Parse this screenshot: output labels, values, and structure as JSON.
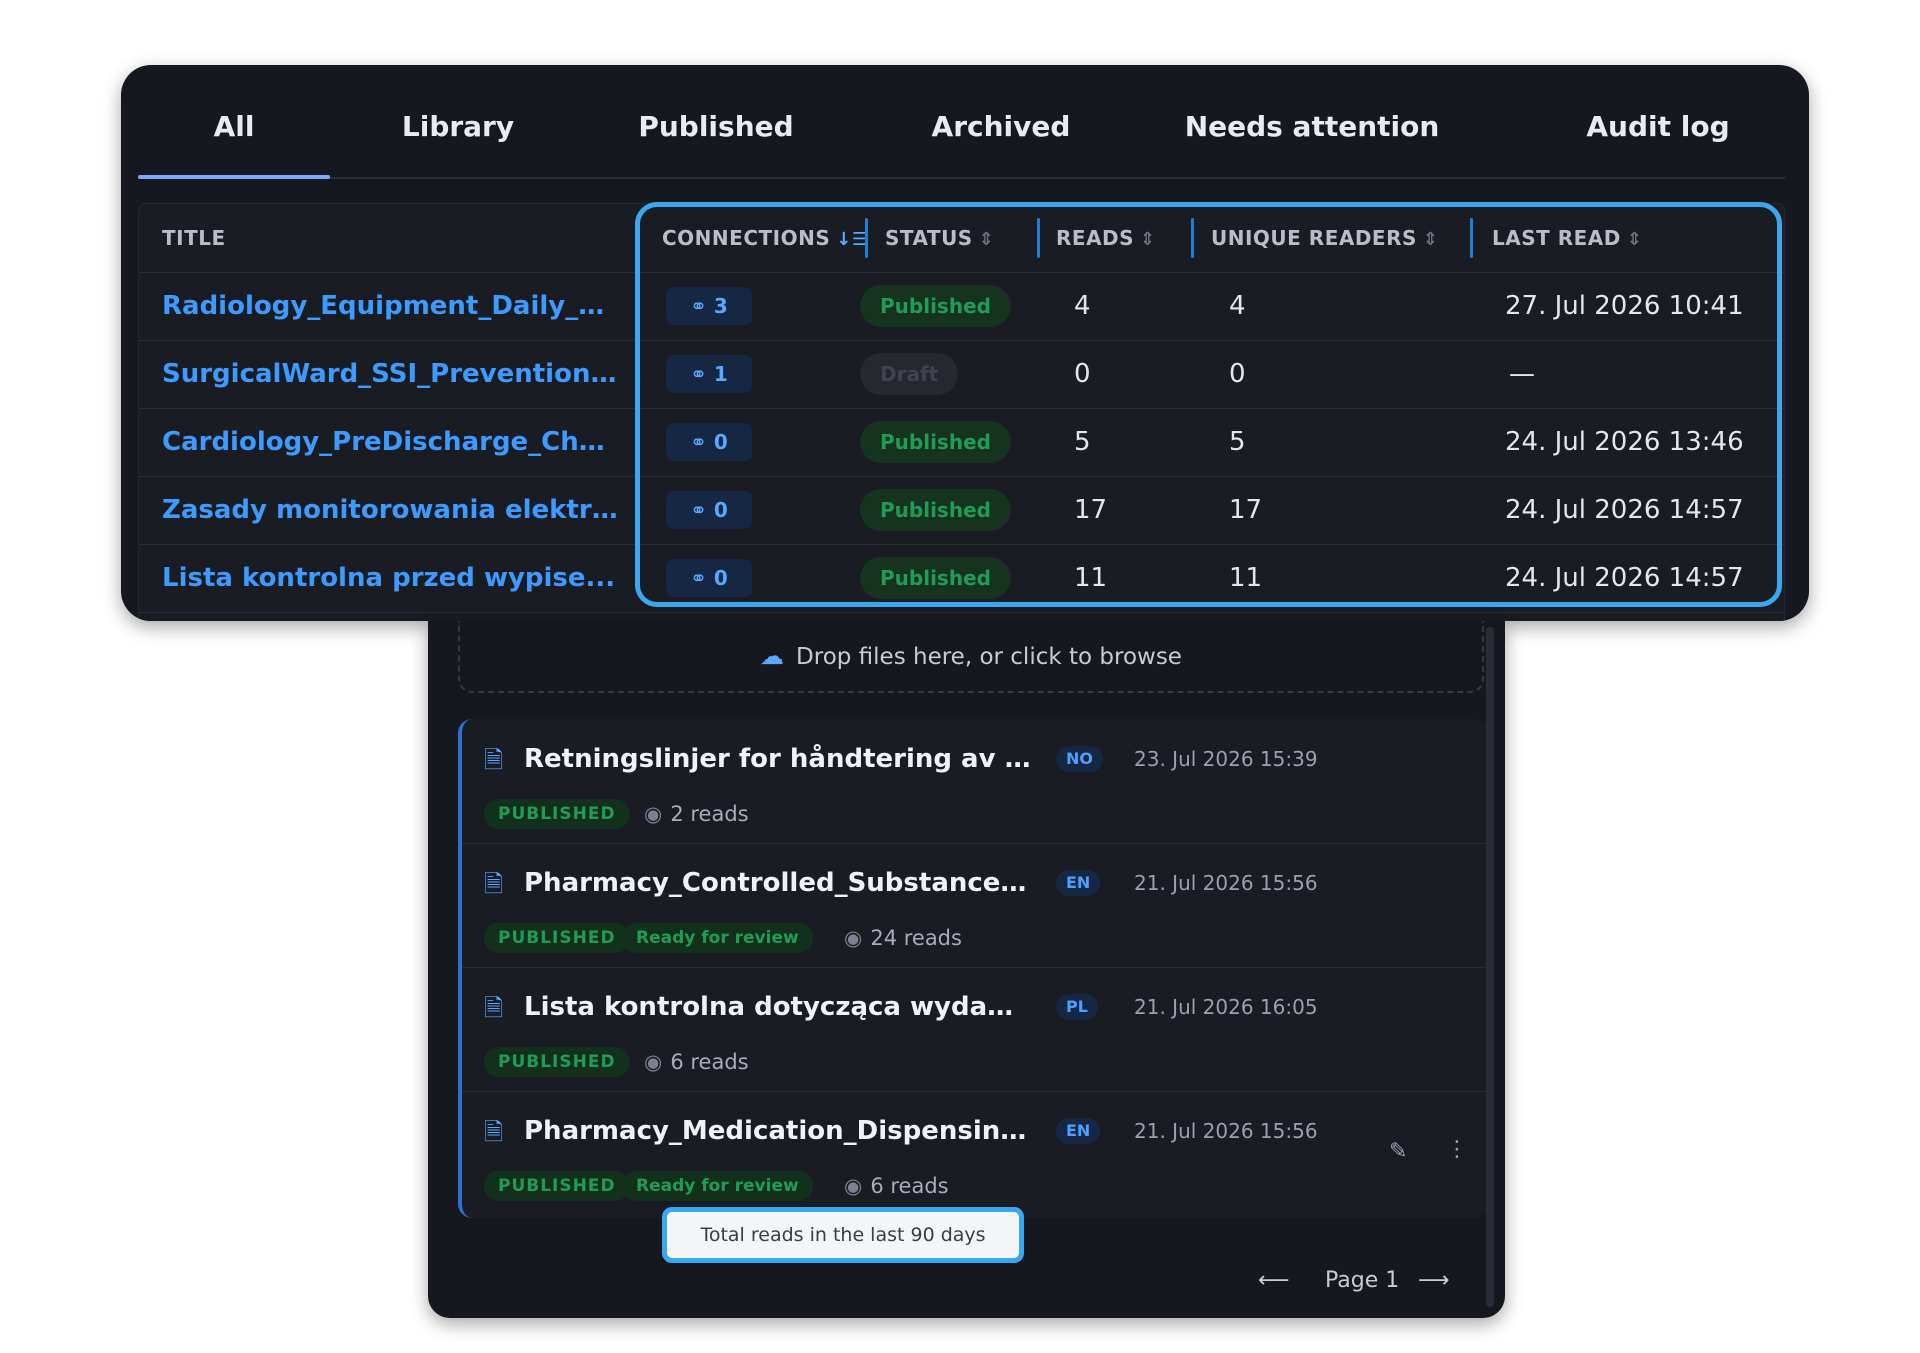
{
  "tabs": [
    "All",
    "Library",
    "Published",
    "Archived",
    "Needs attention",
    "Audit log"
  ],
  "active_tab": "All",
  "table": {
    "headers": {
      "title": "TITLE",
      "connections": "CONNECTIONS",
      "status": "STATUS",
      "reads": "READS",
      "unique_readers": "UNIQUE READERS",
      "last_read": "LAST READ"
    },
    "sort_icons": {
      "connections": "sort-descending-icon",
      "others": "sort-unsorted-icon"
    },
    "rows": [
      {
        "title": "Radiology_Equipment_Daily_S...",
        "connections": "3",
        "status": "Published",
        "reads": "4",
        "unique_readers": "4",
        "last_read": "27. Jul 2026 10:41"
      },
      {
        "title": "SurgicalWard_SSI_Prevention_...",
        "connections": "1",
        "status": "Draft",
        "reads": "0",
        "unique_readers": "0",
        "last_read": "—"
      },
      {
        "title": "Cardiology_PreDischarge_Chec...",
        "connections": "0",
        "status": "Published",
        "reads": "5",
        "unique_readers": "5",
        "last_read": "24. Jul 2026 13:46"
      },
      {
        "title": "Zasady monitorowania elektro...",
        "connections": "0",
        "status": "Published",
        "reads": "17",
        "unique_readers": "17",
        "last_read": "24. Jul 2026 14:57"
      },
      {
        "title": "Lista kontrolna przed wypise...",
        "connections": "0",
        "status": "Published",
        "reads": "11",
        "unique_readers": "11",
        "last_read": "24. Jul 2026 14:57"
      }
    ]
  },
  "dropzone": {
    "text": "Drop files here, or click to browse",
    "icon": "cloud-upload-icon"
  },
  "documents": [
    {
      "name": "Retningslinjer for håndtering av rese...",
      "lang": "NO",
      "date": "23. Jul 2026 15:39",
      "tags": [
        "PUBLISHED"
      ],
      "reads": "2 reads"
    },
    {
      "name": "Pharmacy_Controlled_Substances_P...",
      "lang": "EN",
      "date": "21. Jul 2026 15:56",
      "tags": [
        "PUBLISHED",
        "Ready for review"
      ],
      "reads": "24 reads"
    },
    {
      "name": "Lista kontrolna dotycząca wydawani...",
      "lang": "PL",
      "date": "21. Jul 2026 16:05",
      "tags": [
        "PUBLISHED"
      ],
      "reads": "6 reads"
    },
    {
      "name": "Pharmacy_Medication_Dispensing_C...",
      "lang": "EN",
      "date": "21. Jul 2026 15:56",
      "tags": [
        "PUBLISHED",
        "Ready for review"
      ],
      "reads": "6 reads"
    }
  ],
  "tooltip": "Total reads in the last 90 days",
  "pagination": {
    "label": "Page 1"
  },
  "colors": {
    "accent": "#3d9bff",
    "highlight": "#3aa8f0",
    "published": "#1f9d55",
    "background": "#16181f"
  }
}
